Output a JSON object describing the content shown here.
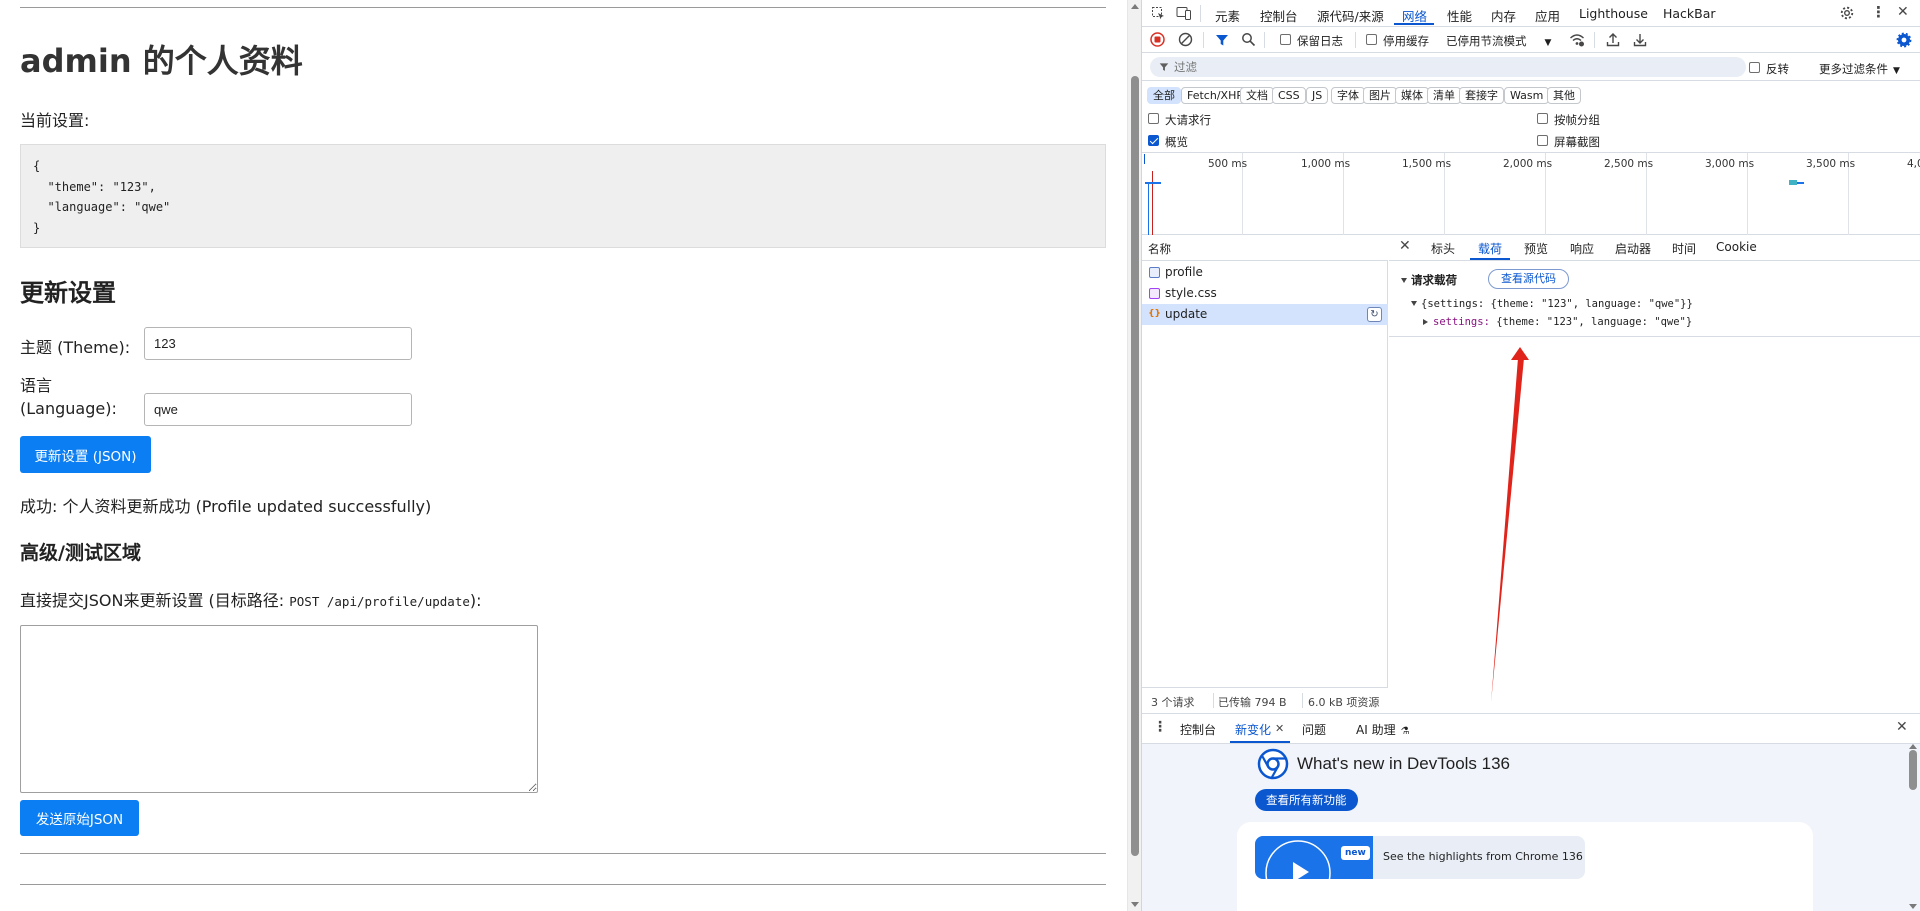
{
  "page": {
    "title": "admin 的个人资料",
    "current_settings_label": "当前设置:",
    "settings_json": "{\n  \"theme\": \"123\",\n  \"language\": \"qwe\"\n}",
    "update_heading": "更新设置",
    "theme_label": "主题 (Theme):",
    "theme_value": "123",
    "language_label_1": "语言",
    "language_label_2": "(Language):",
    "language_value": "qwe",
    "update_button": "更新设置 (JSON)",
    "success_message": "成功: 个人资料更新成功 (Profile updated successfully)",
    "advanced_heading": "高级/测试区域",
    "direct_submit_prefix": "直接提交JSON来更新设置 (目标路径: ",
    "direct_submit_path": "POST /api/profile/update",
    "direct_submit_suffix": "):",
    "raw_json_value": "",
    "send_raw_button": "发送原始JSON"
  },
  "devtools": {
    "main_tabs": [
      "元素",
      "控制台",
      "源代码/来源",
      "网络",
      "性能",
      "内存",
      "应用",
      "Lighthouse",
      "HackBar"
    ],
    "active_main_tab": "网络",
    "toolbar": {
      "preserve_log": "保留日志",
      "disable_cache": "停用缓存",
      "throttle": "已停用节流模式"
    },
    "filter": {
      "placeholder": "过滤",
      "invert": "反转",
      "more_filters": "更多过滤条件"
    },
    "type_chips": [
      "全部",
      "Fetch/XHR",
      "文档",
      "CSS",
      "JS",
      "字体",
      "图片",
      "媒体",
      "清单",
      "套接字",
      "Wasm",
      "其他"
    ],
    "options": {
      "big_rows": "大请求行",
      "group_by_frame": "按帧分组",
      "overview": "概览",
      "screenshots": "屏幕截图",
      "overview_checked": true
    },
    "timeline_ticks": [
      "500 ms",
      "1,000 ms",
      "1,500 ms",
      "2,000 ms",
      "2,500 ms",
      "3,000 ms",
      "3,500 ms",
      "4,0"
    ],
    "request_list": {
      "header": "名称",
      "rows": [
        {
          "name": "profile",
          "type": "doc"
        },
        {
          "name": "style.css",
          "type": "css"
        },
        {
          "name": "update",
          "type": "xhr",
          "selected": true
        }
      ],
      "status": {
        "requests": "3 个请求",
        "transferred": "已传输 794 B",
        "resources": "6.0 kB 项资源"
      }
    },
    "detail_tabs": [
      "标头",
      "载荷",
      "预览",
      "响应",
      "启动器",
      "时间",
      "Cookie"
    ],
    "active_detail_tab": "载荷",
    "payload": {
      "section_title": "请求载荷",
      "view_source": "查看源代码",
      "line1": "{settings: {theme: \"123\", language: \"qwe\"}}",
      "line2_key": "settings",
      "line2_value": "{theme: \"123\", language: \"qwe\"}"
    },
    "drawer": {
      "tabs": [
        "控制台",
        "新变化",
        "问题",
        "AI 助理"
      ],
      "active_tab": "新变化",
      "whats_new_title": "What's new in DevTools 136",
      "whats_new_button": "查看所有新功能",
      "card_badge": "new",
      "card_text": "See the highlights from Chrome 136"
    }
  },
  "colors": {
    "primary_button": "#0a7ef2",
    "devtools_accent": "#0b57d0",
    "annotation_arrow": "#e0241b",
    "record_stop": "#d93025"
  }
}
